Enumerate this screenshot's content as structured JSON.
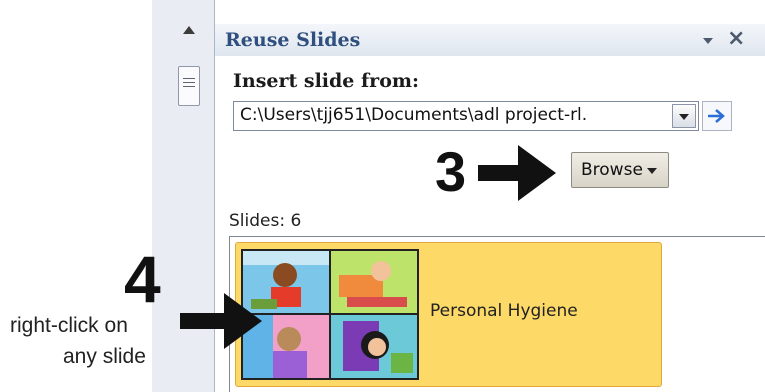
{
  "pane": {
    "title": "Reuse Slides",
    "insert_label": "Insert slide from:",
    "path_value": "C:\\Users\\tjj651\\Documents\\adl project-rl.",
    "browse_label": "Browse",
    "slides_count": "Slides: 6",
    "slides": [
      {
        "name": "Personal Hygiene"
      }
    ]
  },
  "annotations": {
    "step3_number": "3",
    "step4_number": "4",
    "step4_hint_line1": "right-click on",
    "step4_hint_line2": "any slide"
  },
  "icons": {
    "scroll_up": "triangle-up-icon",
    "scroll_thumb": "grip-icon",
    "pane_menu": "chevron-down-icon",
    "pane_close": "close-icon",
    "path_dropdown": "chevron-down-icon",
    "go": "arrow-right-icon",
    "browse_dropdown": "chevron-down-icon"
  },
  "colors": {
    "pane_title": "#2f4f7f",
    "selected_slide_bg": "#fdd968",
    "go_arrow": "#2b6fd6"
  }
}
